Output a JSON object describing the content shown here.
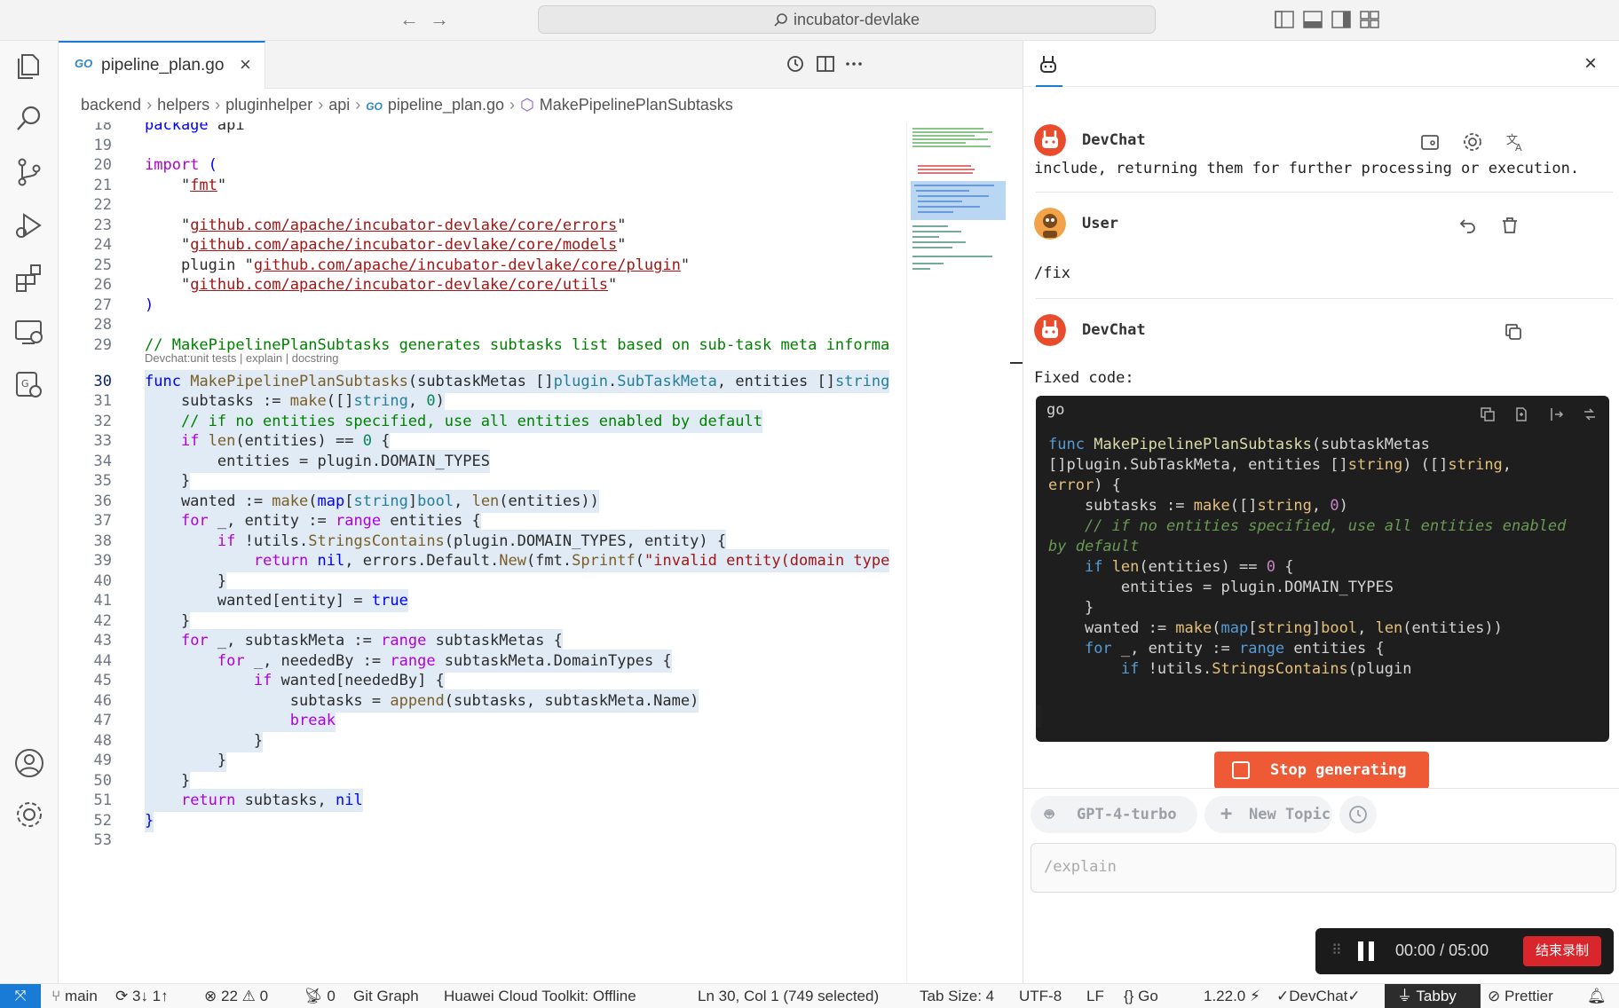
{
  "titlebar": {
    "search_text": "incubator-devlake"
  },
  "editor": {
    "tab": {
      "lang": "GO",
      "filename": "pipeline_plan.go"
    },
    "breadcrumb": [
      "backend",
      "helpers",
      "pluginhelper",
      "api",
      "pipeline_plan.go",
      "MakePipelinePlanSubtasks"
    ],
    "breadcrumb_go_label": "GO",
    "codelens": "Devchat:unit tests | explain | docstring",
    "line_numbers": [
      "18",
      "19",
      "20",
      "21",
      "22",
      "23",
      "24",
      "25",
      "26",
      "27",
      "28",
      "29",
      "30",
      "31",
      "32",
      "33",
      "34",
      "35",
      "36",
      "37",
      "38",
      "39",
      "40",
      "41",
      "42",
      "43",
      "44",
      "45",
      "46",
      "47",
      "48",
      "49",
      "50",
      "51",
      "52",
      "53"
    ],
    "current_line": "30"
  },
  "devchat": {
    "title": "DevChat",
    "prev_text": "include, returning them for further processing or execution.",
    "user_name": "User",
    "user_message": "/fix",
    "bot_name": "DevChat",
    "bot_intro": "Fixed code:",
    "code_lang": "go",
    "stop_label": "Stop generating",
    "model_label": "GPT-4-turbo",
    "new_topic_label": "New Topic",
    "input_placeholder": "/explain"
  },
  "recorder": {
    "elapsed": "00:00",
    "separator": "/",
    "total": "05:00",
    "end_label": "结束录制"
  },
  "statusbar": {
    "branch": "main",
    "sync": "3↓ 1↑",
    "errors": "22",
    "warnings": "0",
    "ports": "0",
    "git_graph": "Git Graph",
    "huawei": "Huawei Cloud Toolkit: Offline",
    "cursor": "Ln 30, Col 1 (749 selected)",
    "tab_size": "Tab Size: 4",
    "encoding": "UTF-8",
    "eol": "LF",
    "language": "Go",
    "go_version": "1.22.0",
    "devchat": "DevChat",
    "tabby": "Tabby",
    "prettier": "Prettier"
  },
  "colors": {
    "accent": "#1a7bd6",
    "stop_button": "#ee5a36",
    "record_end": "#d8262c"
  }
}
